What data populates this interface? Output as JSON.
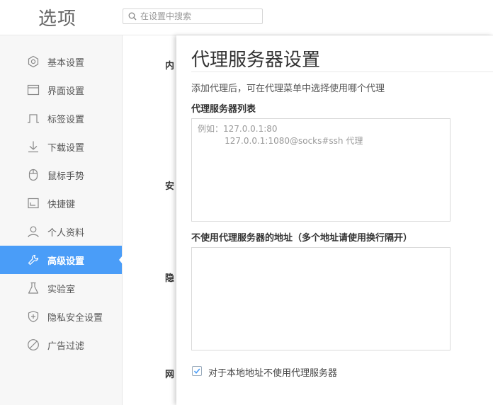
{
  "app": {
    "title": "选项"
  },
  "search": {
    "placeholder": "在设置中搜索",
    "icon": "search-icon"
  },
  "sidebar": {
    "active_color": "#4a9df8",
    "items": [
      {
        "label": "基本设置",
        "icon": "gear-icon"
      },
      {
        "label": "界面设置",
        "icon": "window-icon"
      },
      {
        "label": "标签设置",
        "icon": "tab-icon"
      },
      {
        "label": "下载设置",
        "icon": "download-icon"
      },
      {
        "label": "鼠标手势",
        "icon": "mouse-icon"
      },
      {
        "label": "快捷键",
        "icon": "shortcut-icon"
      },
      {
        "label": "个人资料",
        "icon": "user-icon"
      },
      {
        "label": "高级设置",
        "icon": "wrench-icon",
        "active": true
      },
      {
        "label": "实验室",
        "icon": "flask-icon"
      },
      {
        "label": "隐私安全设置",
        "icon": "shield-icon"
      },
      {
        "label": "广告过滤",
        "icon": "block-icon"
      }
    ]
  },
  "background_sections": [
    "内",
    "安",
    "隐",
    "网"
  ],
  "panel": {
    "title": "代理服务器设置",
    "description": "添加代理后，可在代理菜单中选择使用哪个代理",
    "proxy_list": {
      "label": "代理服务器列表",
      "placeholder": "例如：127.0.0.1:80\n          127.0.0.1:1080@socks#ssh 代理"
    },
    "bypass_list": {
      "label": "不使用代理服务器的地址（多个地址请使用换行隔开）",
      "value": ""
    },
    "bypass_local": {
      "label": "对于本地地址不使用代理服务器",
      "checked": true
    }
  }
}
